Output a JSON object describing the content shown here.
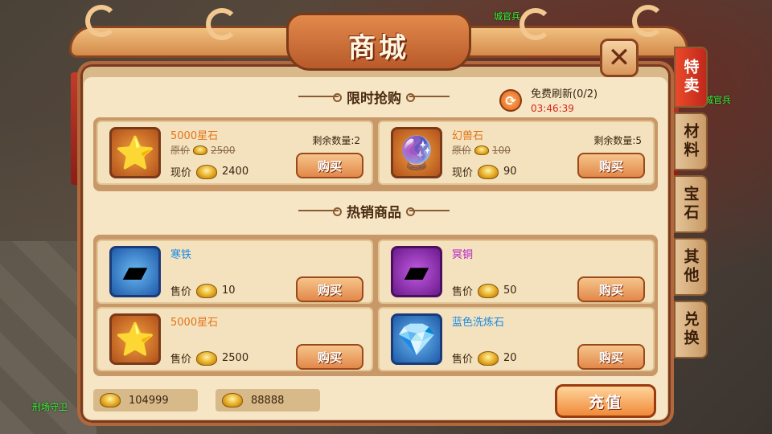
{
  "title": "商城",
  "tabs": [
    "特卖",
    "材料",
    "宝石",
    "其他",
    "兑换"
  ],
  "npc_tags": [
    "城官兵",
    "城官兵",
    "刑场守卫"
  ],
  "limited": {
    "title": "限时抢购",
    "refresh_label": "免费刷新(0/2)",
    "refresh_timer": "03:46:39",
    "orig_label": "原价",
    "now_label": "现价",
    "remain_label": "剩余数量",
    "buy_label": "购买",
    "items": [
      {
        "name": "5000星石",
        "orig_price": "2500",
        "price": "2400",
        "remain": "剩余数量:2",
        "icon": "blue-star-icon"
      },
      {
        "name": "幻兽石",
        "orig_price": "100",
        "price": "90",
        "remain": "剩余数量:5",
        "icon": "beast-stone-icon"
      }
    ]
  },
  "hot": {
    "title": "热销商品",
    "price_label": "售价",
    "buy_label": "购买",
    "items": [
      {
        "name": "寒铁",
        "price": "10",
        "icon": "iron-ingot-icon",
        "color": "blue"
      },
      {
        "name": "冥铜",
        "price": "50",
        "icon": "gold-ingot-icon",
        "color": "purple"
      },
      {
        "name": "5000星石",
        "price": "2500",
        "icon": "blue-star-icon",
        "color": "orange"
      },
      {
        "name": "蓝色洗炼石",
        "price": "20",
        "icon": "blue-gem-icon",
        "color": "blue"
      }
    ]
  },
  "currency": {
    "gold": "104999",
    "bound_gold": "88888"
  },
  "recharge_label": "充值",
  "colors": {
    "accent": "#e2884a",
    "frame": "#b0683c",
    "timer": "#d8281a"
  }
}
